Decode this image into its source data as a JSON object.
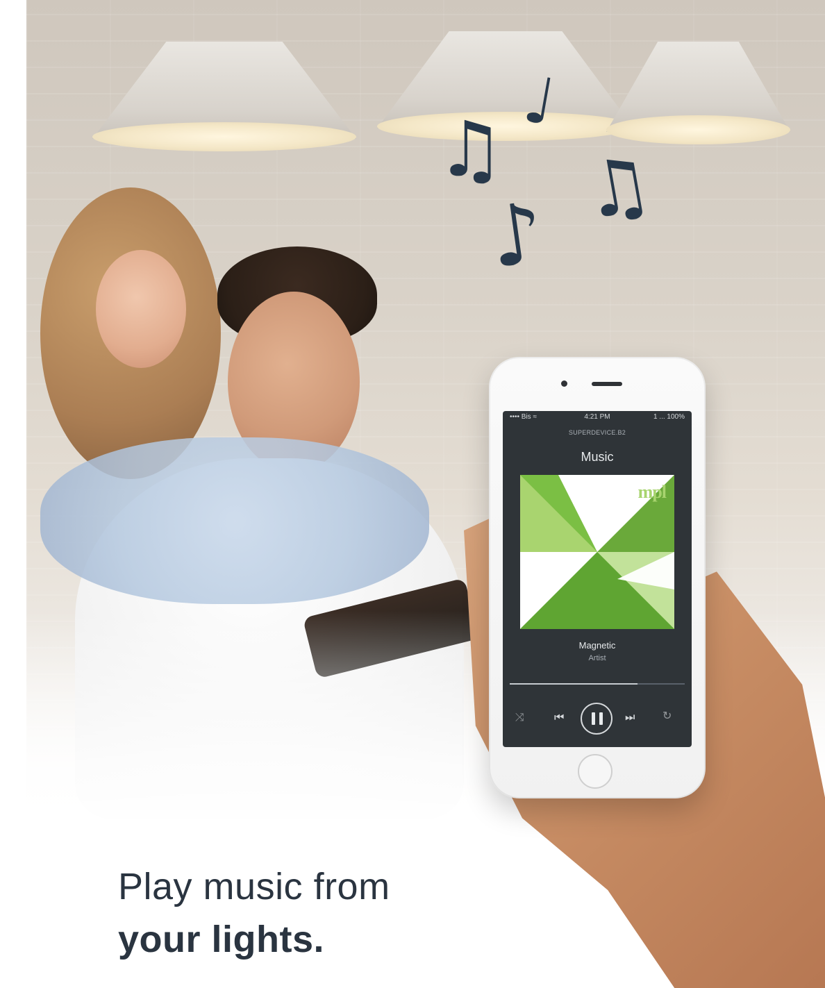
{
  "headline": {
    "line1": "Play music from",
    "line2": "your lights."
  },
  "phone_screen": {
    "status_left": "•••• Bis ≈",
    "status_time": "4:21 PM",
    "status_right": "1 ... 100%",
    "device_name": "SUPERDEVICE.B2",
    "title": "Music",
    "album_mark": "mpl",
    "track_title": "Magnetic",
    "track_artist": "Artist",
    "progress": 0.73
  },
  "icons": {
    "shuffle": "shuffle-icon",
    "previous": "previous-icon",
    "pause": "pause-icon",
    "next": "next-icon",
    "repeat": "repeat-icon",
    "music_notes": "music-note-icon"
  },
  "colors": {
    "note_color": "#27384a",
    "screen_bg": "#2f3438",
    "album_green": "#8cc152",
    "headline_text": "#2a3440"
  }
}
